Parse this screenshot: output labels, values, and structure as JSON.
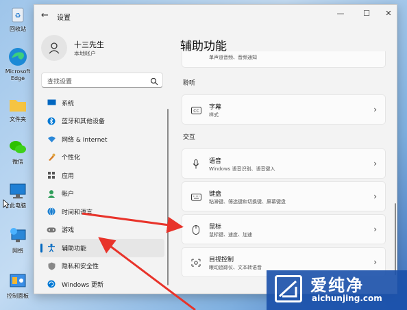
{
  "desktop": {
    "icons": [
      {
        "label": "回收站",
        "icon": "recycle-bin-icon"
      },
      {
        "label": "Microsoft Edge",
        "icon": "edge-icon"
      },
      {
        "label": "文件夹",
        "icon": "folder-icon"
      },
      {
        "label": "微信",
        "icon": "wechat-icon"
      },
      {
        "label": "此电脑",
        "icon": "this-pc-icon"
      },
      {
        "label": "网络",
        "icon": "network-icon"
      },
      {
        "label": "控制面板",
        "icon": "control-panel-icon"
      }
    ]
  },
  "window": {
    "title": "设置",
    "back_icon": "back-arrow-icon"
  },
  "profile": {
    "name": "十三先生",
    "account_type": "本地帐户"
  },
  "search": {
    "placeholder": "查找设置"
  },
  "nav": {
    "items": [
      {
        "label": "系统",
        "icon": "system-icon",
        "color": "#0067c0"
      },
      {
        "label": "蓝牙和其他设备",
        "icon": "bluetooth-icon",
        "color": "#0078d4"
      },
      {
        "label": "网络 & Internet",
        "icon": "wifi-icon",
        "color": "#2b88d8"
      },
      {
        "label": "个性化",
        "icon": "brush-icon",
        "color": "#d9822b"
      },
      {
        "label": "应用",
        "icon": "apps-icon",
        "color": "#555555"
      },
      {
        "label": "帐户",
        "icon": "account-icon",
        "color": "#2f9e5a"
      },
      {
        "label": "时间和语言",
        "icon": "globe-icon",
        "color": "#1a7fd0"
      },
      {
        "label": "游戏",
        "icon": "gamepad-icon",
        "color": "#777777"
      },
      {
        "label": "辅助功能",
        "icon": "accessibility-icon",
        "color": "#0067c0",
        "active": true
      },
      {
        "label": "隐私和安全性",
        "icon": "shield-icon",
        "color": "#888888"
      },
      {
        "label": "Windows 更新",
        "icon": "update-icon",
        "color": "#0078d4"
      }
    ]
  },
  "main": {
    "title": "辅助功能",
    "top_card_sub": "单声道音频、音频通知",
    "sections": {
      "hearing": "聆听",
      "interaction": "交互"
    },
    "cards": [
      {
        "title": "字幕",
        "sub": "样式",
        "icon": "captions-icon"
      },
      {
        "title": "语音",
        "sub": "Windows 语音识别、语音键入",
        "icon": "microphone-icon"
      },
      {
        "title": "键盘",
        "sub": "粘滞键、筛选键和切换键、屏幕键盘",
        "icon": "keyboard-icon"
      },
      {
        "title": "鼠标",
        "sub": "鼠标键、速度、加速",
        "icon": "mouse-icon"
      },
      {
        "title": "目视控制",
        "sub": "眼动追踪仪、文本转语音",
        "icon": "eye-control-icon"
      }
    ]
  },
  "watermark": {
    "brand": "爱纯净",
    "url": "aichunjing.com"
  },
  "colors": {
    "accent": "#0067c0",
    "annotation_arrow": "#e8332a"
  }
}
